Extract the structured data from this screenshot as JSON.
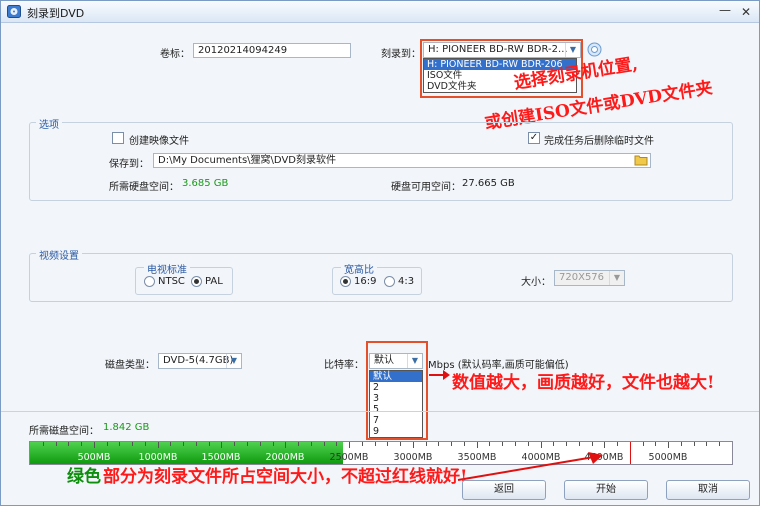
{
  "window": {
    "title": "刻录到DVD",
    "minimize_glyph": "—",
    "close_glyph": "✕"
  },
  "top": {
    "label_volume": "卷标：",
    "volume_value": "20120214094249",
    "label_burn_to": "刻录到：",
    "burn_to_selected": "H: PIONEER  BD-RW   BDR-2...",
    "burn_to_options": [
      "H: PIONEER  BD-RW   BDR-206",
      "ISO文件",
      "DVD文件夹"
    ],
    "burn_to_selected_index": 0
  },
  "options": {
    "title": "选项",
    "create_image_label": "创建映像文件",
    "create_image_checked": false,
    "delete_temp_label": "完成任务后删除临时文件",
    "delete_temp_checked": true,
    "save_to_label": "保存到：",
    "save_to_value": "D:\\My Documents\\狸窝\\DVD刻录软件",
    "required_space_label": "所需硬盘空间：",
    "required_space_value": "3.685 GB",
    "available_space_label": "硬盘可用空间：",
    "available_space_value": "27.665 GB"
  },
  "video": {
    "title": "视频设置",
    "tv_standard_title": "电视标准",
    "ntsc_label": "NTSC",
    "pal_label": "PAL",
    "tv_standard_selected": "PAL",
    "aspect_title": "宽高比",
    "aspect_169": "16:9",
    "aspect_43": "4:3",
    "aspect_selected": "16:9",
    "size_label": "大小：",
    "size_value": "720X576"
  },
  "disc": {
    "type_label": "磁盘类型：",
    "type_value": "DVD-5(4.7GB)",
    "bitrate_label": "比特率：",
    "bitrate_selected": "默认",
    "bitrate_unit": "Mbps (默认码率,画质可能偏低)",
    "bitrate_options": [
      "默认",
      "2",
      "3",
      "5",
      "7",
      "9"
    ],
    "bitrate_selected_index": 0
  },
  "disk_usage": {
    "label": "所需磁盘空间：",
    "value": "1.842 GB",
    "fill_fraction_of_scale": 0.0,
    "scale_labels": [
      "500MB",
      "1000MB",
      "1500MB",
      "2000MB",
      "2500MB",
      "3000MB",
      "3500MB",
      "4000MB",
      "4500MB",
      "5000MB"
    ],
    "used_mb": 1842,
    "limit_mb": 4700
  },
  "buttons": {
    "back": "返回",
    "start": "开始",
    "cancel": "取消"
  },
  "annotations": {
    "burn_target": [
      "选择刻录机位置,",
      "或创建ISO文件或DVD文件夹"
    ],
    "bitrate_note": "数值越大，画质越好，文件也越大!",
    "green_word": "绿色",
    "bar_note": "部分为刻录文件所占空间大小，不超过红线就好!"
  },
  "colors": {
    "accent_blue": "#2a5aa5",
    "annotation_red": "#ff1a1a",
    "space_green": "#1a9a1a",
    "selection_blue": "#3370cc"
  }
}
